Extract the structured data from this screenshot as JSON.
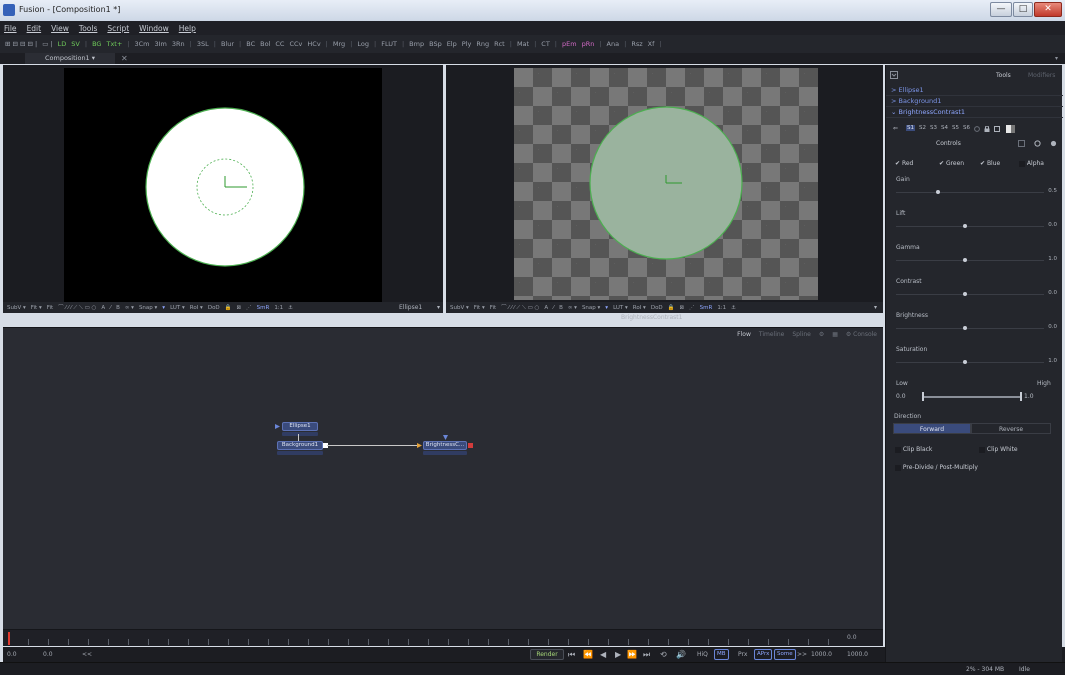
{
  "window": {
    "title": "Fusion - [Composition1 *]",
    "btn_min": "—",
    "btn_max": "□",
    "btn_close": "✕"
  },
  "menubar": [
    "File",
    "Edit",
    "View",
    "Tools",
    "Script",
    "Window",
    "Help"
  ],
  "toolbar": [
    {
      "t": "⊞ ⊟ ⊟ ⊟ |",
      "c": ""
    },
    {
      "t": "▭ |",
      "c": ""
    },
    {
      "t": "LD",
      "c": "green"
    },
    {
      "t": "SV",
      "c": "green"
    },
    {
      "t": "|",
      "c": "sep"
    },
    {
      "t": "BG",
      "c": "green"
    },
    {
      "t": "Txt+",
      "c": "green"
    },
    {
      "t": "|",
      "c": "sep"
    },
    {
      "t": "3Cm",
      "c": ""
    },
    {
      "t": "3Im",
      "c": ""
    },
    {
      "t": "3Rn",
      "c": ""
    },
    {
      "t": "|",
      "c": "sep"
    },
    {
      "t": "3SL",
      "c": ""
    },
    {
      "t": "|",
      "c": "sep"
    },
    {
      "t": "Blur",
      "c": ""
    },
    {
      "t": "|",
      "c": "sep"
    },
    {
      "t": "BC",
      "c": ""
    },
    {
      "t": "Bol",
      "c": ""
    },
    {
      "t": "CC",
      "c": ""
    },
    {
      "t": "CCv",
      "c": ""
    },
    {
      "t": "HCv",
      "c": ""
    },
    {
      "t": "|",
      "c": "sep"
    },
    {
      "t": "Mrg",
      "c": ""
    },
    {
      "t": "|",
      "c": "sep"
    },
    {
      "t": "Log",
      "c": ""
    },
    {
      "t": "|",
      "c": "sep"
    },
    {
      "t": "FLUT",
      "c": ""
    },
    {
      "t": "|",
      "c": "sep"
    },
    {
      "t": "Bmp",
      "c": ""
    },
    {
      "t": "BSp",
      "c": ""
    },
    {
      "t": "Elp",
      "c": ""
    },
    {
      "t": "Ply",
      "c": ""
    },
    {
      "t": "Rng",
      "c": ""
    },
    {
      "t": "Rct",
      "c": ""
    },
    {
      "t": "|",
      "c": "sep"
    },
    {
      "t": "Mat",
      "c": ""
    },
    {
      "t": "|",
      "c": "sep"
    },
    {
      "t": "CT",
      "c": ""
    },
    {
      "t": "|",
      "c": "sep"
    },
    {
      "t": "pEm",
      "c": "pink"
    },
    {
      "t": "pRn",
      "c": "pink"
    },
    {
      "t": "|",
      "c": "sep"
    },
    {
      "t": "Ana",
      "c": ""
    },
    {
      "t": "|",
      "c": "sep"
    },
    {
      "t": "Rsz",
      "c": ""
    },
    {
      "t": "Xf",
      "c": ""
    },
    {
      "t": "|",
      "c": "sep"
    }
  ],
  "tabs": {
    "composition": "Composition1 ▾",
    "close": "✕",
    "dropdown": "▾"
  },
  "viewer_left": {
    "bar": [
      "SubV ▾",
      "Fit ▾",
      "Fit",
      "⌒ ⁄ ⁄ ⁄ ⟋ ⟍ ▭ ○",
      "A",
      "⁄",
      "B",
      "∞ ▾",
      "Snap ▾",
      "▾",
      "LUT ▾",
      "RoI ▾",
      "DoD",
      "🔒",
      "⊠",
      "⋰",
      "SmR",
      "1:1",
      "⚓"
    ],
    "name": "Ellipse1",
    "menu": "▾"
  },
  "viewer_right": {
    "bar": [
      "SubV ▾",
      "Fit ▾",
      "Fit",
      "⌒ ⁄ ⁄ ⁄ ⟋ ⟍ ▭ ○",
      "A",
      "⁄",
      "B",
      "∞ ▾",
      "Snap ▾",
      "▾",
      "LUT ▾",
      "RoI ▾",
      "DoD",
      "🔒",
      "⊠",
      "⋰",
      "SmR",
      "1:1",
      "⚓"
    ],
    "name": "BrightnessContrast1",
    "menu": "▾"
  },
  "flow": {
    "tabs": [
      "Flow",
      "Timeline",
      "Spline",
      "⚙",
      "▦",
      "⚙ Console"
    ],
    "nodes": {
      "ellipse": "Ellipse1",
      "background": "Background1",
      "bc": "BrightnessC..."
    }
  },
  "timeline": {
    "end_value": "0.0"
  },
  "transport": {
    "start": "0.0",
    "current": "0.0",
    "range_marker": "<<",
    "render": "Render",
    "controls": [
      "⏮",
      "⏪",
      "◀",
      "▶",
      "⏩",
      "⏭",
      "⟲",
      "🔊"
    ],
    "hiq": "HiQ",
    "mb": "MB",
    "prx": "Prx",
    "aprx": "APrx",
    "some": "Some",
    "end_marker": ">>",
    "end": "1000.0",
    "end_render": "1000.0"
  },
  "status": {
    "memory": "2% - 304 MB",
    "state": "Idle"
  },
  "inspector": {
    "tabs": {
      "tools": "Tools",
      "modifiers": "Modifiers"
    },
    "tool_list": [
      "> Ellipse1",
      "> Background1",
      "⌄ BrightnessContrast1"
    ],
    "channel_row": {
      "icons": "⇐",
      "s1": "S1",
      "s2": "S2",
      "s3": "S3",
      "s4": "S4",
      "s5": "S5",
      "s6": "S6"
    },
    "controls_tab": "Controls",
    "checks": {
      "red": "Red",
      "green": "Green",
      "blue": "Blue",
      "alpha": "Alpha"
    },
    "params": [
      {
        "label": "Gain",
        "value": "0.5",
        "knob": 0.27
      },
      {
        "label": "Lift",
        "value": "0.0",
        "knob": 0.45
      },
      {
        "label": "Gamma",
        "value": "1.0",
        "knob": 0.45
      },
      {
        "label": "Contrast",
        "value": "0.0",
        "knob": 0.45
      },
      {
        "label": "Brightness",
        "value": "0.0",
        "knob": 0.45
      },
      {
        "label": "Saturation",
        "value": "1.0",
        "knob": 0.45
      }
    ],
    "range": {
      "low_label": "Low",
      "high_label": "High",
      "low": "0.0",
      "high": "1.0"
    },
    "direction": {
      "label": "Direction",
      "forward": "Forward",
      "reverse": "Reverse"
    },
    "clip_black": "Clip Black",
    "clip_white": "Clip White",
    "premultiply": "Pre-Divide / Post-Multiply"
  },
  "colors": {
    "accent": "#6a86d8",
    "selection_green": "#5fb84a",
    "node_blue": "#3a4b7c",
    "playhead": "#e03a2f"
  }
}
